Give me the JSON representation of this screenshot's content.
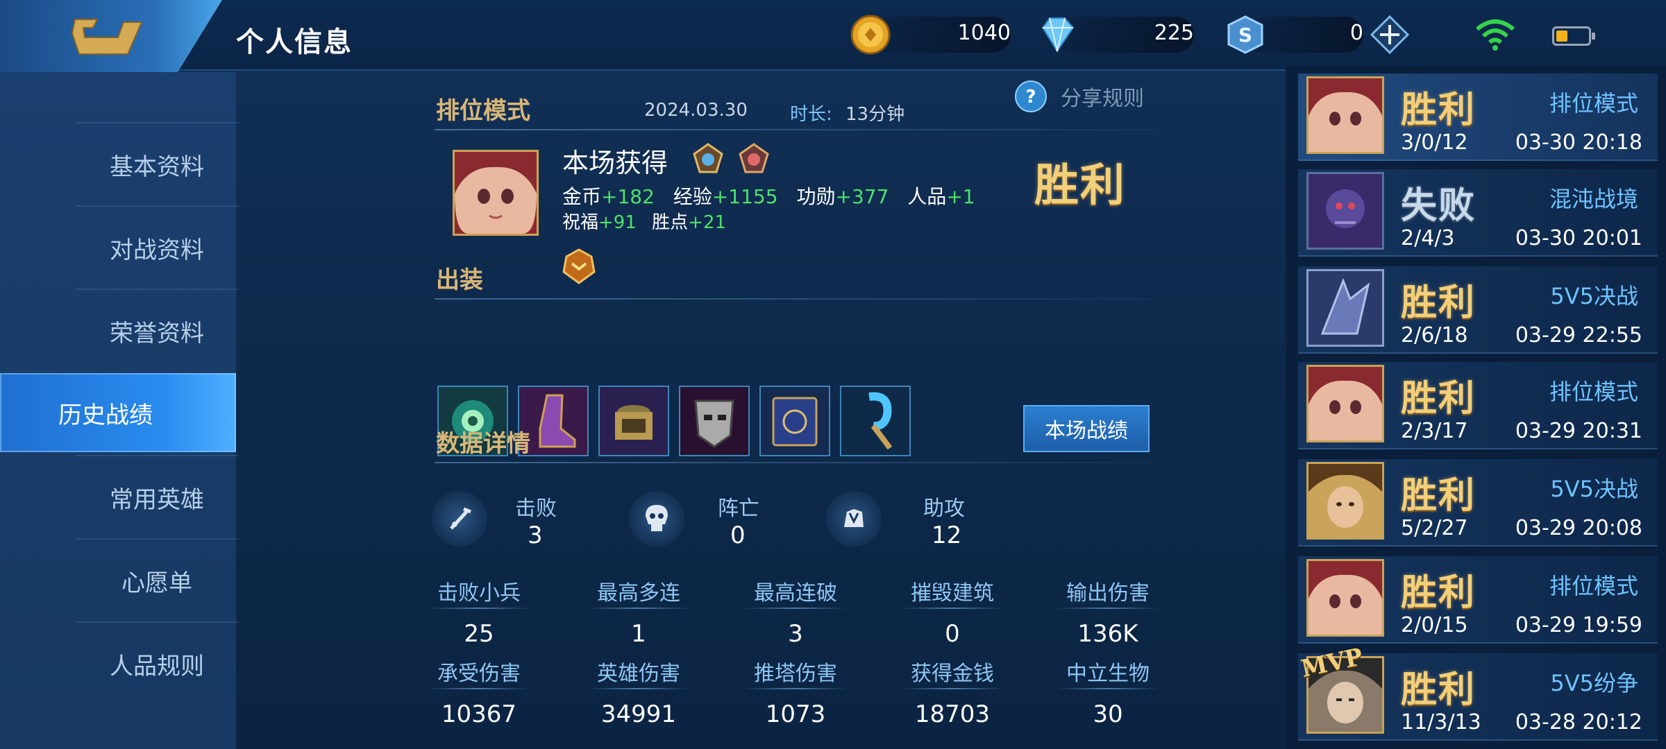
{
  "header": {
    "title": "个人信息",
    "gold": "1040",
    "diamonds": "225",
    "vouchers": "0"
  },
  "sidebar": {
    "items": [
      {
        "label": "基本资料"
      },
      {
        "label": "对战资料"
      },
      {
        "label": "荣誉资料"
      },
      {
        "label": "历史战绩"
      },
      {
        "label": "常用英雄"
      },
      {
        "label": "心愿单"
      },
      {
        "label": "人品规则"
      }
    ],
    "active": "历史战绩"
  },
  "match": {
    "mode": "排位模式",
    "date": "2024.03.30",
    "duration_label": "时长:",
    "duration": "13分钟",
    "share_rules": "分享规则",
    "obtained_title": "本场获得",
    "result": "胜利",
    "rewards_line1": [
      {
        "label": "金币",
        "value": "+182"
      },
      {
        "label": "经验",
        "value": "+1155"
      },
      {
        "label": "功勋",
        "value": "+377"
      },
      {
        "label": "人品",
        "value": "+1"
      }
    ],
    "rewards_line2": [
      {
        "label": "祝福",
        "value": "+91"
      },
      {
        "label": "胜点",
        "value": "+21"
      }
    ]
  },
  "equipment": {
    "title": "出装",
    "items": [
      "item-1",
      "item-2",
      "item-3",
      "item-4",
      "item-5",
      "item-6"
    ]
  },
  "details": {
    "title": "数据详情",
    "button": "本场战绩",
    "kills_label": "击败",
    "kills": "3",
    "deaths_label": "阵亡",
    "deaths": "0",
    "assists_label": "助攻",
    "assists": "12",
    "grid": [
      {
        "label": "击败小兵",
        "value": "25"
      },
      {
        "label": "最高多连",
        "value": "1"
      },
      {
        "label": "最高连破",
        "value": "3"
      },
      {
        "label": "摧毁建筑",
        "value": "0"
      },
      {
        "label": "输出伤害",
        "value": "136K"
      },
      {
        "label": "承受伤害",
        "value": "10367"
      },
      {
        "label": "英雄伤害",
        "value": "34991"
      },
      {
        "label": "推塔伤害",
        "value": "1073"
      },
      {
        "label": "获得金钱",
        "value": "18703"
      },
      {
        "label": "中立生物",
        "value": "30"
      }
    ]
  },
  "history": [
    {
      "result": "胜利",
      "kda": "3/0/12",
      "mode": "排位模式",
      "time": "03-30 20:18",
      "win": true
    },
    {
      "result": "失败",
      "kda": "2/4/3",
      "mode": "混沌战境",
      "time": "03-30 20:01",
      "win": false
    },
    {
      "result": "胜利",
      "kda": "2/6/18",
      "mode": "5V5决战",
      "time": "03-29 22:55",
      "win": true
    },
    {
      "result": "胜利",
      "kda": "2/3/17",
      "mode": "排位模式",
      "time": "03-29 20:31",
      "win": true
    },
    {
      "result": "胜利",
      "kda": "5/2/27",
      "mode": "5V5决战",
      "time": "03-29 20:08",
      "win": true
    },
    {
      "result": "胜利",
      "kda": "2/0/15",
      "mode": "排位模式",
      "time": "03-29 19:59",
      "win": true
    },
    {
      "result": "胜利",
      "kda": "11/3/13",
      "mode": "5V5纷争",
      "time": "03-28 20:12",
      "win": true,
      "mvp": "MVP"
    }
  ],
  "colors": {
    "gold_text": "#d9b777",
    "green": "#4ee06a",
    "blue_label": "#7cc4f7",
    "active_tab": "#2a8cf0"
  }
}
